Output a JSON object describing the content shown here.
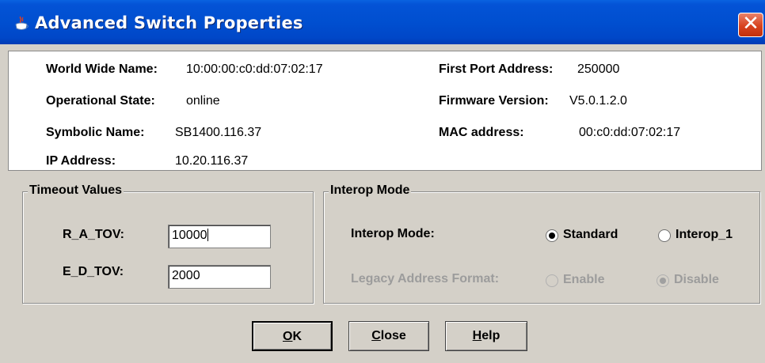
{
  "window": {
    "title": "Advanced Switch Properties",
    "close_glyph": "✕"
  },
  "info": {
    "world_wide_name_label": "World Wide Name:",
    "world_wide_name": "10:00:00:c0:dd:07:02:17",
    "operational_state_label": "Operational State:",
    "operational_state": "online",
    "symbolic_name_label": "Symbolic Name:",
    "symbolic_name": "SB1400.116.37",
    "ip_address_label": "IP Address:",
    "ip_address": "10.20.116.37",
    "first_port_address_label": "First Port Address:",
    "first_port_address": "250000",
    "firmware_version_label": "Firmware Version:",
    "firmware_version": "V5.0.1.2.0",
    "mac_address_label": "MAC address:",
    "mac_address": "00:c0:dd:07:02:17"
  },
  "timeout": {
    "legend": "Timeout Values",
    "r_a_tov_label": "R_A_TOV:",
    "r_a_tov_value": "10000",
    "e_d_tov_label": "E_D_TOV:",
    "e_d_tov_value": "2000"
  },
  "interop": {
    "legend": "Interop Mode",
    "mode_label": "Interop Mode:",
    "standard_label": "Standard",
    "interop1_label": "Interop_1",
    "selected_mode": "Standard",
    "legacy_label": "Legacy Address Format:",
    "enable_label": "Enable",
    "disable_label": "Disable",
    "selected_legacy": "Disable"
  },
  "buttons": {
    "ok_mnemonic": "O",
    "ok_rest": "K",
    "close_mnemonic": "C",
    "close_rest": "lose",
    "help_mnemonic": "H",
    "help_rest": "elp"
  },
  "colors": {
    "title_bar": "#0453d6",
    "close_button": "#d8431f",
    "dialog_bg": "#d4d0c8",
    "disabled_text": "#9c9c9c"
  }
}
